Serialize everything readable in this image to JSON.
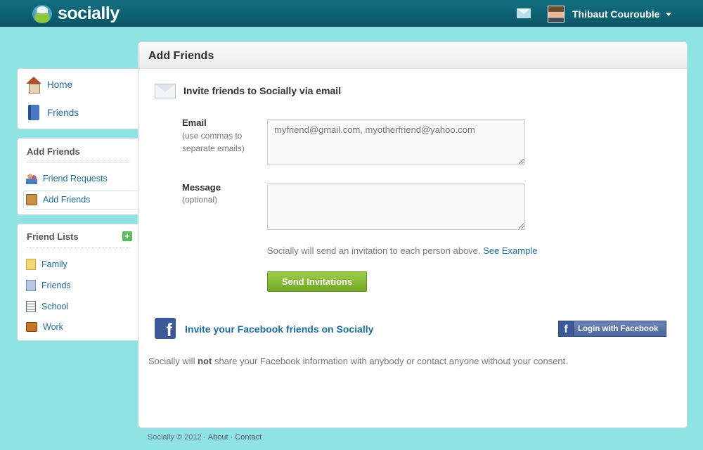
{
  "app": {
    "logo": "socially"
  },
  "topbar": {
    "user_name": "Thibaut Courouble"
  },
  "nav": {
    "primary": [
      {
        "label": "Home"
      },
      {
        "label": "Friends"
      }
    ],
    "add_friends": {
      "title": "Add Friends",
      "items": [
        {
          "label": "Friend Requests"
        },
        {
          "label": "Add Friends"
        }
      ]
    },
    "friend_lists": {
      "title": "Friend Lists",
      "add_icon": "+",
      "items": [
        {
          "label": "Family"
        },
        {
          "label": "Friends"
        },
        {
          "label": "School"
        },
        {
          "label": "Work"
        }
      ]
    }
  },
  "main": {
    "title": "Add Friends",
    "email_section": {
      "title": "Invite friends to Socially via email",
      "email_label": "Email",
      "email_hint": "(use commas to separate emails)",
      "email_placeholder": "myfriend@gmail.com, myotherfriend@yahoo.com",
      "message_label": "Message",
      "message_hint": "(optional)",
      "message_placeholder": "",
      "note": "Socially will send an invitation to each person above.",
      "note_link": "See Example",
      "send_label": "Send Invitations"
    },
    "facebook_section": {
      "title": "Invite your Facebook friends on Socially",
      "login_label": "Login with Facebook",
      "privacy_before": "Socially will",
      "privacy_bold": "not",
      "privacy_after": "share your Facebook information with anybody or contact anyone without your consent."
    }
  },
  "footer": {
    "copyright": "Socially © 2012",
    "links": [
      "About",
      "Contact"
    ]
  }
}
